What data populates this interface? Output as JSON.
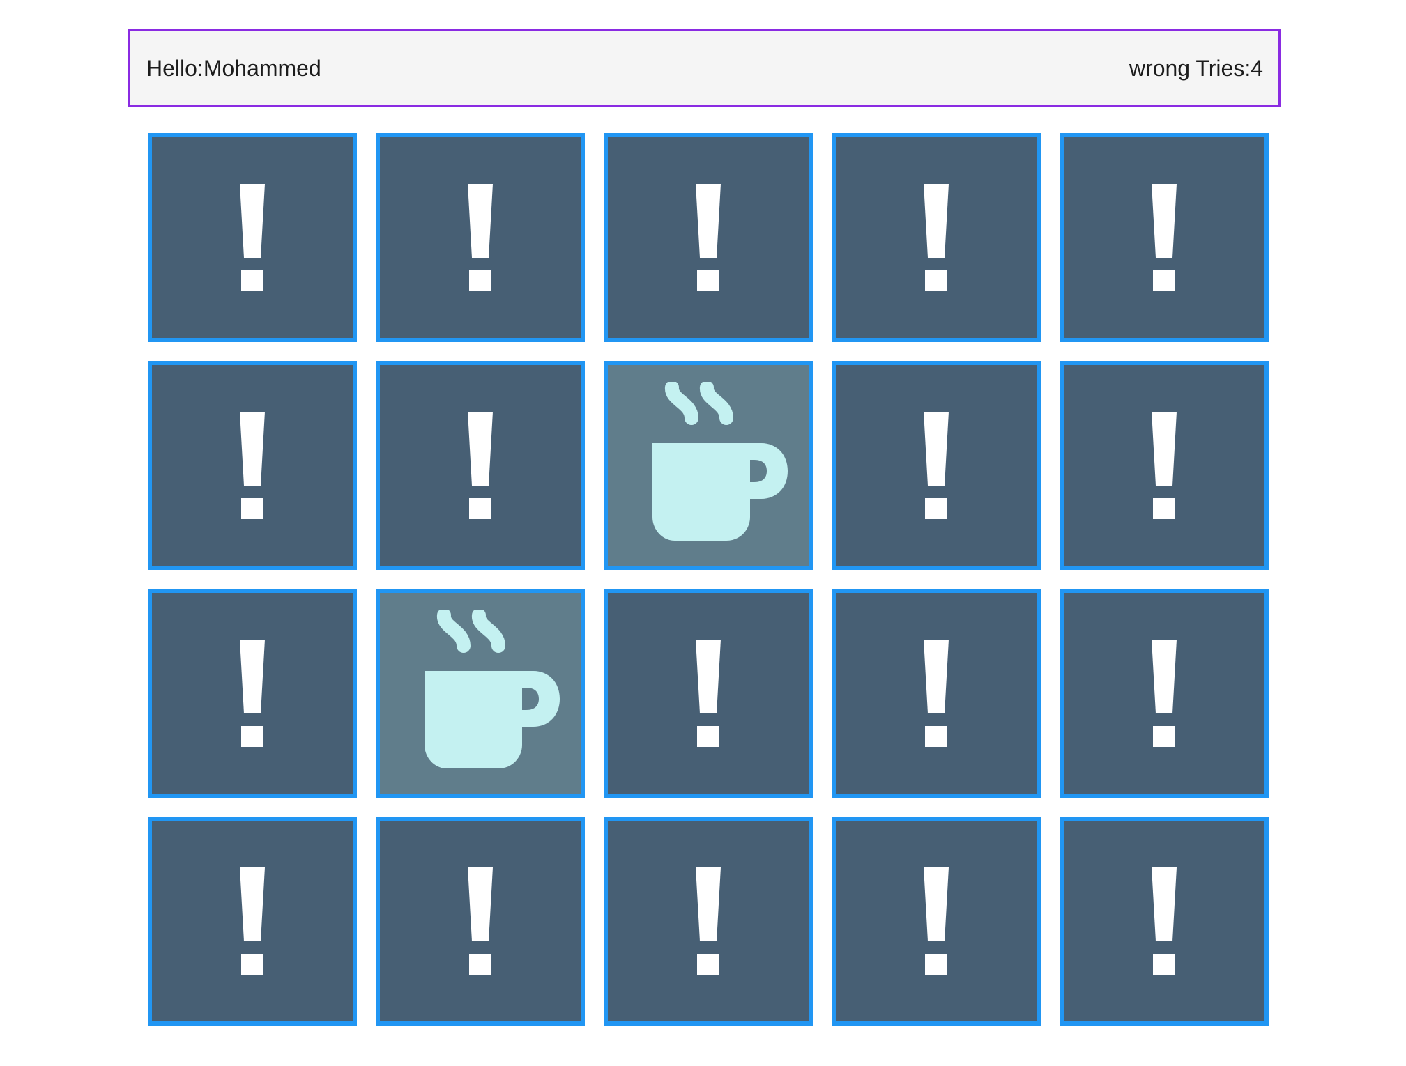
{
  "header": {
    "greeting": "Hello:Mohammed",
    "wrong_tries": "wrong Tries:4"
  },
  "colors": {
    "card_back": "#475f74",
    "card_flipped": "#607d8b",
    "card_border": "#2196f3",
    "header_border": "#8a2be2",
    "icon_light": "#c4f1f1",
    "question_mark": "#ffffff"
  },
  "board": {
    "columns": 5,
    "rows": 4,
    "cards": [
      {
        "state": "hidden",
        "icon": "exclamation-icon"
      },
      {
        "state": "hidden",
        "icon": "exclamation-icon"
      },
      {
        "state": "hidden",
        "icon": "exclamation-icon"
      },
      {
        "state": "hidden",
        "icon": "exclamation-icon"
      },
      {
        "state": "hidden",
        "icon": "exclamation-icon"
      },
      {
        "state": "hidden",
        "icon": "exclamation-icon"
      },
      {
        "state": "hidden",
        "icon": "exclamation-icon"
      },
      {
        "state": "flipped",
        "icon": "coffee-icon"
      },
      {
        "state": "hidden",
        "icon": "exclamation-icon"
      },
      {
        "state": "hidden",
        "icon": "exclamation-icon"
      },
      {
        "state": "hidden",
        "icon": "exclamation-icon"
      },
      {
        "state": "flipped",
        "icon": "coffee-icon"
      },
      {
        "state": "hidden",
        "icon": "exclamation-icon"
      },
      {
        "state": "hidden",
        "icon": "exclamation-icon"
      },
      {
        "state": "hidden",
        "icon": "exclamation-icon"
      },
      {
        "state": "hidden",
        "icon": "exclamation-icon"
      },
      {
        "state": "hidden",
        "icon": "exclamation-icon"
      },
      {
        "state": "hidden",
        "icon": "exclamation-icon"
      },
      {
        "state": "hidden",
        "icon": "exclamation-icon"
      },
      {
        "state": "hidden",
        "icon": "exclamation-icon"
      }
    ]
  }
}
